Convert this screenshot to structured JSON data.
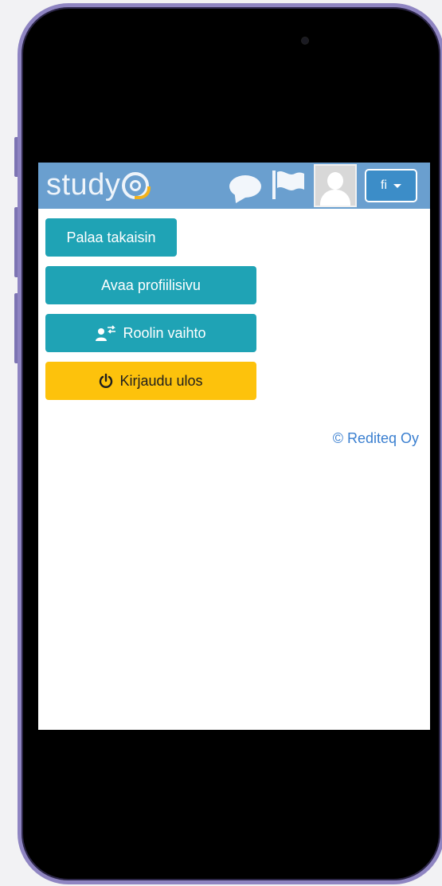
{
  "header": {
    "logo_text": "study",
    "language_label": "fi"
  },
  "icons": {
    "chat": "chat-bubble-icon",
    "flag": "flag-icon",
    "avatar": "user-avatar-icon",
    "role_switch": "user-swap-icon",
    "power": "power-icon"
  },
  "actions": {
    "back_label": "Palaa takaisin",
    "profile_label": "Avaa profiilisivu",
    "role_switch_label": "Roolin vaihto",
    "logout_label": "Kirjaudu ulos"
  },
  "footer": {
    "copyright": "© Rediteq Oy"
  },
  "colors": {
    "topbar": "#6a9fcf",
    "primary_button": "#1fa3b5",
    "logout_button": "#fdc20c",
    "link": "#3a7fd0",
    "logo_accent": "#f2b21c"
  }
}
